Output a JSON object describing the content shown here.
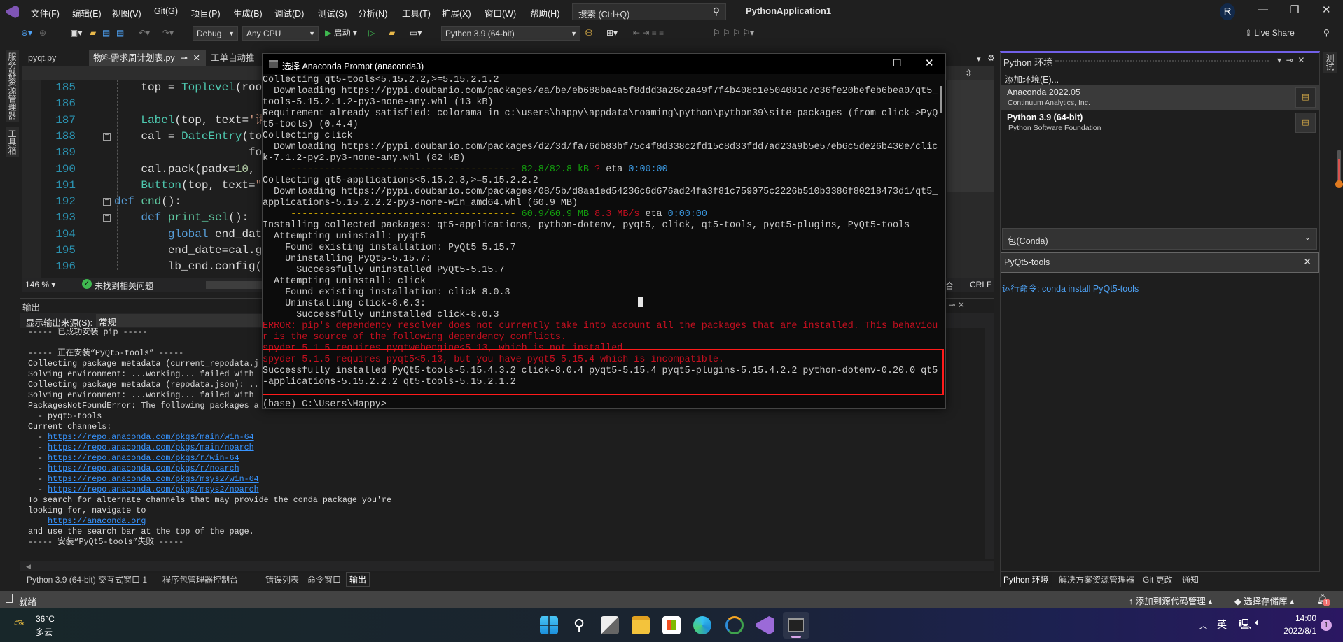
{
  "colors": {
    "accent": "#7160e8",
    "terminal_error": "#c50f1f",
    "highlight_box": "#ff1a1a",
    "link": "#3794ff"
  },
  "title_bar": {
    "menu": [
      "文件(F)",
      "编辑(E)",
      "视图(V)",
      "Git(G)",
      "项目(P)",
      "生成(B)",
      "调试(D)",
      "测试(S)",
      "分析(N)",
      "工具(T)",
      "扩展(X)",
      "窗口(W)",
      "帮助(H)"
    ],
    "search_placeholder": "搜索 (Ctrl+Q)",
    "app_title": "PythonApplication1",
    "avatar": "R"
  },
  "toolbar": {
    "config": "Debug",
    "platform": "Any CPU",
    "start": "启动",
    "interpreter": "Python 3.9 (64-bit)",
    "live_share": "Live Share"
  },
  "left_strip": [
    "服务器资源管理器",
    "工具箱"
  ],
  "editor": {
    "tabs": [
      {
        "label": "pyqt.py",
        "active": false
      },
      {
        "label": "物料需求周计划表.py",
        "active": true
      },
      {
        "label": "工单自动推送.",
        "active": false
      }
    ],
    "lines": [
      {
        "num": "185",
        "tokens": [
          {
            "t": "    top = ",
            "c": "id"
          },
          {
            "t": "Toplevel",
            "c": "cls"
          },
          {
            "t": "(roo",
            "c": "id"
          }
        ]
      },
      {
        "num": "186",
        "tokens": []
      },
      {
        "num": "187",
        "tokens": [
          {
            "t": "    ",
            "c": "id"
          },
          {
            "t": "Label",
            "c": "cls"
          },
          {
            "t": "(top, text=",
            "c": "id"
          },
          {
            "t": "'请",
            "c": "str"
          }
        ]
      },
      {
        "num": "188",
        "fold": true,
        "tokens": [
          {
            "t": "    cal = ",
            "c": "id"
          },
          {
            "t": "DateEntry",
            "c": "cls"
          },
          {
            "t": "(to",
            "c": "id"
          }
        ]
      },
      {
        "num": "189",
        "tokens": [
          {
            "t": "                    fo",
            "c": "id"
          }
        ]
      },
      {
        "num": "190",
        "tokens": [
          {
            "t": "    cal.pack(padx=",
            "c": "id"
          },
          {
            "t": "10",
            "c": "num"
          },
          {
            "t": ", p",
            "c": "id"
          }
        ]
      },
      {
        "num": "191",
        "tokens": [
          {
            "t": "    ",
            "c": "id"
          },
          {
            "t": "Button",
            "c": "cls"
          },
          {
            "t": "(top, text=",
            "c": "id"
          },
          {
            "t": "\"",
            "c": "str"
          }
        ]
      },
      {
        "num": "192",
        "fold": true,
        "tokens": [
          {
            "t": "def ",
            "c": "kw"
          },
          {
            "t": "end",
            "c": "fn"
          },
          {
            "t": "():",
            "c": "id"
          }
        ]
      },
      {
        "num": "193",
        "fold": true,
        "tokens": [
          {
            "t": "    def ",
            "c": "kw"
          },
          {
            "t": "print_sel",
            "c": "fn"
          },
          {
            "t": "():",
            "c": "id"
          }
        ]
      },
      {
        "num": "194",
        "tokens": [
          {
            "t": "        global ",
            "c": "kw"
          },
          {
            "t": "end_date",
            "c": "id"
          }
        ]
      },
      {
        "num": "195",
        "tokens": [
          {
            "t": "        end_date=cal.ge",
            "c": "id"
          }
        ]
      },
      {
        "num": "196",
        "tokens": [
          {
            "t": "        lb_end.config(",
            "c": "id"
          }
        ]
      }
    ],
    "zoom": "146 %",
    "issues": "未找到相关问题",
    "encoding_fragment": "合",
    "line_ending": "CRLF"
  },
  "output": {
    "title": "输出",
    "source_label": "显示输出来源(S):",
    "source_value": "常规",
    "lines": [
      {
        "t": "----- 已成功安装 pip -----"
      },
      {
        "t": ""
      },
      {
        "t": "----- 正在安装“PyQt5-tools” -----"
      },
      {
        "t": "Collecting package metadata (current_repodata.j"
      },
      {
        "t": "Solving environment: ...working... failed with"
      },
      {
        "t": "Collecting package metadata (repodata.json): .."
      },
      {
        "t": "Solving environment: ...working... failed with"
      },
      {
        "t": "PackagesNotFoundError: The following packages a"
      },
      {
        "t": "  - pyqt5-tools"
      },
      {
        "t": "Current channels:"
      },
      {
        "p": "  - ",
        "t": "https://repo.anaconda.com/pkgs/main/win-64",
        "link": true
      },
      {
        "p": "  - ",
        "t": "https://repo.anaconda.com/pkgs/main/noarch",
        "link": true
      },
      {
        "p": "  - ",
        "t": "https://repo.anaconda.com/pkgs/r/win-64",
        "link": true
      },
      {
        "p": "  - ",
        "t": "https://repo.anaconda.com/pkgs/r/noarch",
        "link": true
      },
      {
        "p": "  - ",
        "t": "https://repo.anaconda.com/pkgs/msys2/win-64",
        "link": true
      },
      {
        "p": "  - ",
        "t": "https://repo.anaconda.com/pkgs/msys2/noarch",
        "link": true
      },
      {
        "t": "To search for alternate channels that may provide the conda package you're"
      },
      {
        "t": "looking for, navigate to"
      },
      {
        "p": "    ",
        "t": "https://anaconda.org",
        "link": true
      },
      {
        "t": "and use the search bar at the top of the page."
      },
      {
        "t": "----- 安装“PyQt5-tools”失败 -----"
      }
    ],
    "bottom_tabs": [
      "Python 3.9 (64-bit) 交互式窗口 1",
      "程序包管理器控制台",
      "错误列表",
      "命令窗口",
      "输出"
    ]
  },
  "terminal": {
    "title": "选择 Anaconda Prompt (anaconda3)",
    "lines": [
      [
        {
          "t": "Collecting qt5-tools<5.15.2.2,>=5.15.2.1.2",
          "c": "w"
        }
      ],
      [
        {
          "t": "  Downloading https://pypi.doubanio.com/packages/ea/be/eb688ba4a5f8ddd3a26c2a49f7f4b408c1e504081c7c36fe20befeb6bea0/qt5_",
          "c": "w"
        }
      ],
      [
        {
          "t": "tools-5.15.2.1.2-py3-none-any.whl (13 kB)",
          "c": "w"
        }
      ],
      [
        {
          "t": "Requirement already satisfied: colorama in c:\\users\\happy\\appdata\\roaming\\python\\python39\\site-packages (from click->PyQ",
          "c": "w"
        }
      ],
      [
        {
          "t": "t5-tools) (0.4.4)",
          "c": "w"
        }
      ],
      [
        {
          "t": "Collecting click",
          "c": "w"
        }
      ],
      [
        {
          "t": "  Downloading https://pypi.doubanio.com/packages/d2/3d/fa76db83bf75c4f8d338c2fd15c8d33fdd7ad23a9b5e57eb6c5de26b430e/clic",
          "c": "w"
        }
      ],
      [
        {
          "t": "k-7.1.2-py2.py3-none-any.whl (82 kB)",
          "c": "w"
        }
      ],
      [
        {
          "t": "     ---------------------------------------- ",
          "c": "y"
        },
        {
          "t": "82.8/82.8 kB",
          "c": "g"
        },
        {
          "t": " ",
          "c": "w"
        },
        {
          "t": "?",
          "c": "r"
        },
        {
          "t": " eta ",
          "c": "w"
        },
        {
          "t": "0:00:00",
          "c": "b"
        }
      ],
      [
        {
          "t": "Collecting qt5-applications<5.15.2.3,>=5.15.2.2.2",
          "c": "w"
        }
      ],
      [
        {
          "t": "  Downloading https://pypi.doubanio.com/packages/08/5b/d8aa1ed54236c6d676ad24fa3f81c759075c2226b510b3386f80218473d1/qt5_",
          "c": "w"
        }
      ],
      [
        {
          "t": "applications-5.15.2.2.2-py3-none-win_amd64.whl (60.9 MB)",
          "c": "w"
        }
      ],
      [
        {
          "t": "     ---------------------------------------- ",
          "c": "y"
        },
        {
          "t": "60.9/60.9 MB",
          "c": "g"
        },
        {
          "t": " ",
          "c": "w"
        },
        {
          "t": "8.3 MB/s",
          "c": "r"
        },
        {
          "t": " eta ",
          "c": "w"
        },
        {
          "t": "0:00:00",
          "c": "b"
        }
      ],
      [
        {
          "t": "Installing collected packages: qt5-applications, python-dotenv, pyqt5, click, qt5-tools, pyqt5-plugins, PyQt5-tools",
          "c": "w"
        }
      ],
      [
        {
          "t": "  Attempting uninstall: pyqt5",
          "c": "w"
        }
      ],
      [
        {
          "t": "    Found existing installation: PyQt5 5.15.7",
          "c": "w"
        }
      ],
      [
        {
          "t": "    Uninstalling PyQt5-5.15.7:",
          "c": "w"
        }
      ],
      [
        {
          "t": "      Successfully uninstalled PyQt5-5.15.7",
          "c": "w"
        }
      ],
      [
        {
          "t": "  Attempting uninstall: click",
          "c": "w"
        }
      ],
      [
        {
          "t": "    Found existing installation: click 8.0.3",
          "c": "w"
        }
      ],
      [
        {
          "t": "    Uninstalling click-8.0.3:",
          "c": "w"
        }
      ],
      [
        {
          "t": "      Successfully uninstalled click-8.0.3",
          "c": "w"
        }
      ],
      [
        {
          "t": "ERROR: pip's dependency resolver does not currently take into account all the packages that are installed. This behaviou",
          "c": "r"
        }
      ],
      [
        {
          "t": "r is the source of the following dependency conflicts.",
          "c": "r"
        }
      ],
      [
        {
          "t": "spyder 5.1.5 requires pyqtwebengine<5.13, which is not installed.",
          "c": "r"
        }
      ],
      [
        {
          "t": "spyder 5.1.5 requires pyqt5<5.13, but you have pyqt5 5.15.4 which is incompatible.",
          "c": "r"
        }
      ],
      [
        {
          "t": "Successfully installed PyQt5-tools-5.15.4.3.2 click-8.0.4 pyqt5-5.15.4 pyqt5-plugins-5.15.4.2.2 python-dotenv-0.20.0 qt5",
          "c": "w"
        }
      ],
      [
        {
          "t": "-applications-5.15.2.2.2 qt5-tools-5.15.2.1.2",
          "c": "w"
        }
      ],
      [],
      [
        {
          "t": "(base) C:\\Users\\Happy>",
          "c": "w"
        }
      ]
    ]
  },
  "python_env": {
    "title": "Python 环境",
    "add_env": "添加环境(E)...",
    "environments": [
      {
        "name": "Anaconda 2022.05",
        "vendor": "Continuum Analytics, Inc.",
        "selected": true
      },
      {
        "name": "Python 3.9 (64-bit)",
        "vendor": "Python Software Foundation",
        "selected": false,
        "bold": true
      }
    ],
    "view_select": "包(Conda)",
    "search_value": "PyQt5-tools",
    "run_command": "运行命令: conda install PyQt5-tools",
    "bottom_tabs": [
      "Python 环境",
      "解决方案资源管理器",
      "Git 更改",
      "通知"
    ]
  },
  "right_strip": {
    "label": "测试"
  },
  "statusbar": {
    "ready": "就绪",
    "add_source_control": "添加到源代码管理",
    "select_repo": "选择存储库",
    "notification_count": "1"
  },
  "taskbar": {
    "weather_temp": "36°C",
    "weather_desc": "多云",
    "apps": [
      "windows-start",
      "search",
      "task-view",
      "file-explorer",
      "microsoft-store",
      "edge",
      "anaconda-navigator",
      "visual-studio",
      "terminal"
    ],
    "ime": "英",
    "time": "14:00",
    "date": "2022/8/1",
    "notification_badge": "1"
  }
}
